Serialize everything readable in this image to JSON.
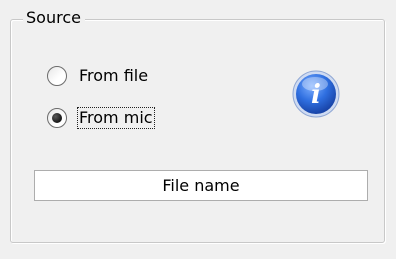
{
  "group": {
    "title": "Source"
  },
  "options": [
    {
      "label": "From file",
      "selected": false
    },
    {
      "label": "From mic",
      "selected": true
    }
  ],
  "info_icon": {
    "name": "info-icon",
    "glyph": "i",
    "color": "#2a63d6"
  },
  "file_button": {
    "label": "File name"
  }
}
